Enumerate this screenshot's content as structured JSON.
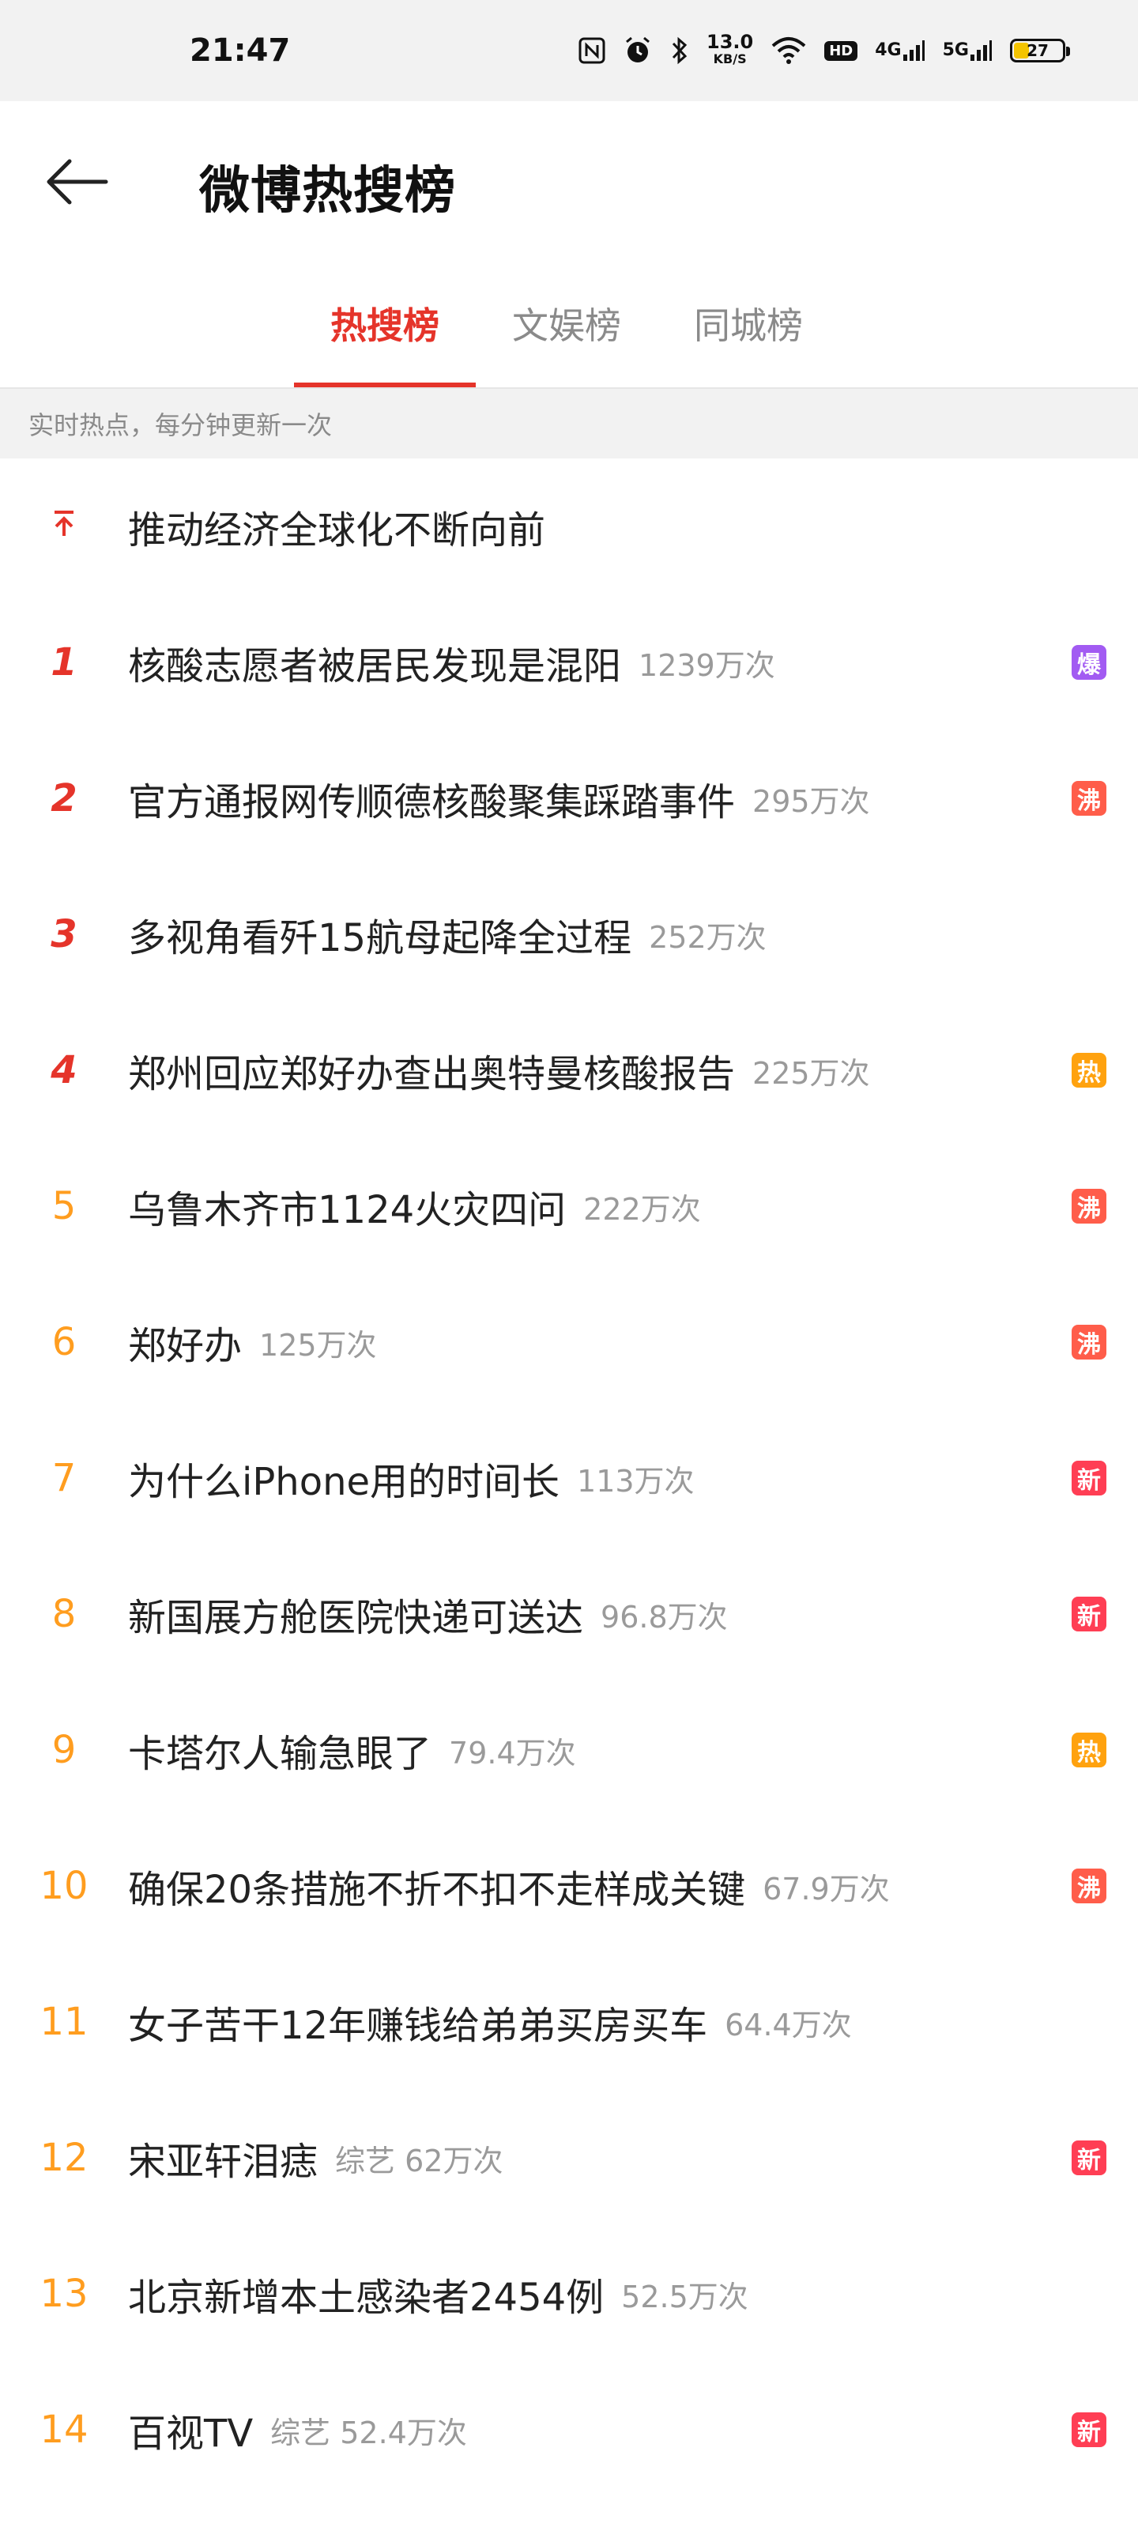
{
  "status_bar": {
    "time": "21:47",
    "network_speed": "13.0",
    "network_unit": "KB/S",
    "hd": "HD",
    "signal_4g": "4G",
    "signal_5g": "5G",
    "battery": "27"
  },
  "header": {
    "title": "微博热搜榜"
  },
  "tabs": [
    {
      "label": "热搜榜",
      "active": true
    },
    {
      "label": "文娱榜",
      "active": false
    },
    {
      "label": "同城榜",
      "active": false
    }
  ],
  "subtitle": "实时热点，每分钟更新一次",
  "pinned": {
    "title": "推动经济全球化不断向前"
  },
  "list": [
    {
      "rank": "1",
      "title": "核酸志愿者被居民发现是混阳",
      "meta": "1239万次",
      "badge": "爆"
    },
    {
      "rank": "2",
      "title": "官方通报网传顺德核酸聚集踩踏事件",
      "meta": "295万次",
      "badge": "沸"
    },
    {
      "rank": "3",
      "title": "多视角看歼15航母起降全过程",
      "meta": "252万次",
      "badge": ""
    },
    {
      "rank": "4",
      "title": "郑州回应郑好办查出奥特曼核酸报告",
      "meta": "225万次",
      "badge": "热"
    },
    {
      "rank": "5",
      "title": "乌鲁木齐市1124火灾四问",
      "meta": "222万次",
      "badge": "沸"
    },
    {
      "rank": "6",
      "title": "郑好办",
      "meta": "125万次",
      "badge": "沸"
    },
    {
      "rank": "7",
      "title": "为什么iPhone用的时间长",
      "meta": "113万次",
      "badge": "新"
    },
    {
      "rank": "8",
      "title": "新国展方舱医院快递可送达",
      "meta": "96.8万次",
      "badge": "新"
    },
    {
      "rank": "9",
      "title": "卡塔尔人输急眼了",
      "meta": "79.4万次",
      "badge": "热"
    },
    {
      "rank": "10",
      "title": "确保20条措施不折不扣不走样成关键",
      "meta": "67.9万次",
      "badge": "沸"
    },
    {
      "rank": "11",
      "title": "女子苦干12年赚钱给弟弟买房买车",
      "meta": "64.4万次",
      "badge": ""
    },
    {
      "rank": "12",
      "title": "宋亚轩泪痣",
      "meta": "综艺 62万次",
      "badge": "新"
    },
    {
      "rank": "13",
      "title": "北京新增本土感染者2454例",
      "meta": "52.5万次",
      "badge": ""
    },
    {
      "rank": "14",
      "title": "百视TV",
      "meta": "综艺 52.4万次",
      "badge": "新"
    }
  ]
}
